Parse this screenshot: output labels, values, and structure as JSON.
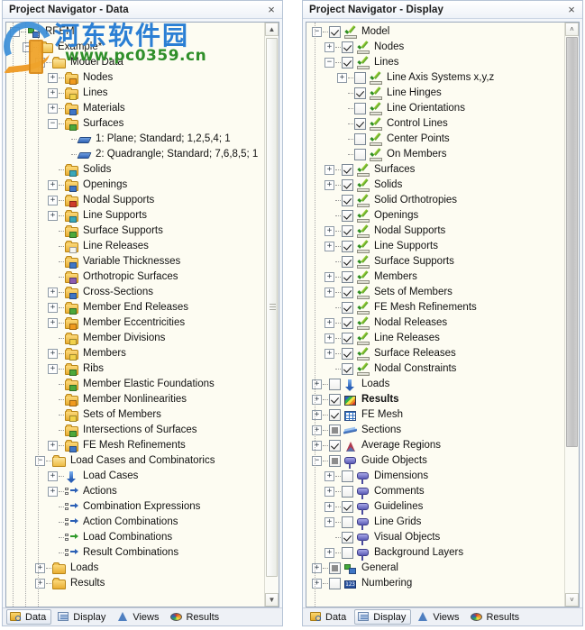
{
  "left_panel": {
    "title": "Project Navigator - Data",
    "close_label": "×",
    "tabs": [
      {
        "label": "Data",
        "icon": "data-icon",
        "active": true
      },
      {
        "label": "Display",
        "icon": "display-icon",
        "active": false
      },
      {
        "label": "Views",
        "icon": "views-icon",
        "active": false
      },
      {
        "label": "Results",
        "icon": "results-icon",
        "active": false
      }
    ],
    "tree": [
      {
        "label": "RFEM",
        "depth": 0,
        "expander": "minus",
        "icon": "rfem",
        "bold": false
      },
      {
        "label": "Example*",
        "depth": 1,
        "expander": "minus",
        "icon": "folder-open",
        "bold": false
      },
      {
        "label": "Model Data",
        "depth": 2,
        "expander": "minus",
        "icon": "folder-open",
        "bold": false
      },
      {
        "label": "Nodes",
        "depth": 3,
        "expander": "plus",
        "icon": "folder-orange",
        "bold": false
      },
      {
        "label": "Lines",
        "depth": 3,
        "expander": "plus",
        "icon": "folder-yellow",
        "bold": false
      },
      {
        "label": "Materials",
        "depth": 3,
        "expander": "plus",
        "icon": "folder-blue",
        "bold": false
      },
      {
        "label": "Surfaces",
        "depth": 3,
        "expander": "minus",
        "icon": "folder-green",
        "bold": false
      },
      {
        "label": "1: Plane; Standard; 1,2,5,4; 1",
        "depth": 4,
        "expander": "none",
        "icon": "surface",
        "bold": false
      },
      {
        "label": "2: Quadrangle; Standard; 7,6,8,5; 1",
        "depth": 4,
        "expander": "none",
        "icon": "surface",
        "bold": false
      },
      {
        "label": "Solids",
        "depth": 3,
        "expander": "none",
        "icon": "folder-cyan",
        "bold": false
      },
      {
        "label": "Openings",
        "depth": 3,
        "expander": "plus",
        "icon": "folder-blue",
        "bold": false
      },
      {
        "label": "Nodal Supports",
        "depth": 3,
        "expander": "plus",
        "icon": "folder-red",
        "bold": false
      },
      {
        "label": "Line Supports",
        "depth": 3,
        "expander": "plus",
        "icon": "folder-cyan",
        "bold": false
      },
      {
        "label": "Surface Supports",
        "depth": 3,
        "expander": "none",
        "icon": "folder-green",
        "bold": false
      },
      {
        "label": "Line Releases",
        "depth": 3,
        "expander": "none",
        "icon": "folder-white",
        "bold": false
      },
      {
        "label": "Variable Thicknesses",
        "depth": 3,
        "expander": "none",
        "icon": "folder-blue",
        "bold": false
      },
      {
        "label": "Orthotropic Surfaces",
        "depth": 3,
        "expander": "none",
        "icon": "folder-purple",
        "bold": false
      },
      {
        "label": "Cross-Sections",
        "depth": 3,
        "expander": "plus",
        "icon": "folder-blue",
        "bold": false
      },
      {
        "label": "Member End Releases",
        "depth": 3,
        "expander": "plus",
        "icon": "folder-green",
        "bold": false
      },
      {
        "label": "Member Eccentricities",
        "depth": 3,
        "expander": "plus",
        "icon": "folder-orange",
        "bold": false
      },
      {
        "label": "Member Divisions",
        "depth": 3,
        "expander": "none",
        "icon": "folder-yellow",
        "bold": false
      },
      {
        "label": "Members",
        "depth": 3,
        "expander": "plus",
        "icon": "folder-yellow",
        "bold": false
      },
      {
        "label": "Ribs",
        "depth": 3,
        "expander": "plus",
        "icon": "folder-green",
        "bold": false
      },
      {
        "label": "Member Elastic Foundations",
        "depth": 3,
        "expander": "none",
        "icon": "folder-green",
        "bold": false
      },
      {
        "label": "Member Nonlinearities",
        "depth": 3,
        "expander": "none",
        "icon": "folder-orange",
        "bold": false
      },
      {
        "label": "Sets of Members",
        "depth": 3,
        "expander": "none",
        "icon": "folder-yellow",
        "bold": false
      },
      {
        "label": "Intersections of Surfaces",
        "depth": 3,
        "expander": "none",
        "icon": "folder-green",
        "bold": false
      },
      {
        "label": "FE Mesh Refinements",
        "depth": 3,
        "expander": "plus",
        "icon": "folder-blue",
        "bold": false
      },
      {
        "label": "Load Cases and Combinatorics",
        "depth": 2,
        "expander": "minus",
        "icon": "folder-open",
        "bold": false
      },
      {
        "label": "Load Cases",
        "depth": 3,
        "expander": "plus",
        "icon": "load-arrow",
        "bold": false
      },
      {
        "label": "Actions",
        "depth": 3,
        "expander": "plus",
        "icon": "combination",
        "bold": false
      },
      {
        "label": "Combination Expressions",
        "depth": 3,
        "expander": "none",
        "icon": "combination",
        "bold": false
      },
      {
        "label": "Action Combinations",
        "depth": 3,
        "expander": "none",
        "icon": "combination",
        "bold": false
      },
      {
        "label": "Load Combinations",
        "depth": 3,
        "expander": "none",
        "icon": "combination-green",
        "bold": false
      },
      {
        "label": "Result Combinations",
        "depth": 3,
        "expander": "none",
        "icon": "combination",
        "bold": false
      },
      {
        "label": "Loads",
        "depth": 2,
        "expander": "plus",
        "icon": "folder-plain",
        "bold": false
      },
      {
        "label": "Results",
        "depth": 2,
        "expander": "plus",
        "icon": "folder-plain",
        "bold": false
      }
    ],
    "scrollbar": {
      "up_arrow": "▲",
      "down_arrow": "▼"
    }
  },
  "right_panel": {
    "title": "Project Navigator - Display",
    "close_label": "×",
    "tabs": [
      {
        "label": "Data",
        "icon": "data-icon",
        "active": false
      },
      {
        "label": "Display",
        "icon": "display-icon",
        "active": true
      },
      {
        "label": "Views",
        "icon": "views-icon",
        "active": false
      },
      {
        "label": "Results",
        "icon": "results-icon",
        "active": false
      }
    ],
    "tree": [
      {
        "label": "Model",
        "depth": 0,
        "expander": "minus",
        "check": "checked",
        "icon": "display",
        "bold": false
      },
      {
        "label": "Nodes",
        "depth": 1,
        "expander": "plus",
        "check": "checked",
        "icon": "display",
        "bold": false
      },
      {
        "label": "Lines",
        "depth": 1,
        "expander": "minus",
        "check": "checked",
        "icon": "display",
        "bold": false
      },
      {
        "label": "Line Axis Systems x,y,z",
        "depth": 2,
        "expander": "plus",
        "check": "unchecked",
        "icon": "display",
        "bold": false
      },
      {
        "label": "Line Hinges",
        "depth": 2,
        "expander": "none",
        "check": "checked",
        "icon": "display",
        "bold": false
      },
      {
        "label": "Line Orientations",
        "depth": 2,
        "expander": "none",
        "check": "unchecked",
        "icon": "display",
        "bold": false
      },
      {
        "label": "Control Lines",
        "depth": 2,
        "expander": "none",
        "check": "checked",
        "icon": "display",
        "bold": false
      },
      {
        "label": "Center Points",
        "depth": 2,
        "expander": "none",
        "check": "unchecked",
        "icon": "display",
        "bold": false
      },
      {
        "label": "On Members",
        "depth": 2,
        "expander": "none",
        "check": "unchecked",
        "icon": "display",
        "bold": false
      },
      {
        "label": "Surfaces",
        "depth": 1,
        "expander": "plus",
        "check": "checked",
        "icon": "display",
        "bold": false
      },
      {
        "label": "Solids",
        "depth": 1,
        "expander": "plus",
        "check": "checked",
        "icon": "display",
        "bold": false
      },
      {
        "label": "Solid Orthotropies",
        "depth": 1,
        "expander": "none",
        "check": "checked",
        "icon": "display",
        "bold": false
      },
      {
        "label": "Openings",
        "depth": 1,
        "expander": "none",
        "check": "checked",
        "icon": "display",
        "bold": false
      },
      {
        "label": "Nodal Supports",
        "depth": 1,
        "expander": "plus",
        "check": "checked",
        "icon": "display",
        "bold": false
      },
      {
        "label": "Line Supports",
        "depth": 1,
        "expander": "plus",
        "check": "checked",
        "icon": "display",
        "bold": false
      },
      {
        "label": "Surface Supports",
        "depth": 1,
        "expander": "none",
        "check": "checked",
        "icon": "display",
        "bold": false
      },
      {
        "label": "Members",
        "depth": 1,
        "expander": "plus",
        "check": "checked",
        "icon": "display",
        "bold": false
      },
      {
        "label": "Sets of Members",
        "depth": 1,
        "expander": "plus",
        "check": "checked",
        "icon": "display",
        "bold": false
      },
      {
        "label": "FE Mesh Refinements",
        "depth": 1,
        "expander": "none",
        "check": "checked",
        "icon": "display",
        "bold": false
      },
      {
        "label": "Nodal Releases",
        "depth": 1,
        "expander": "plus",
        "check": "checked",
        "icon": "display",
        "bold": false
      },
      {
        "label": "Line Releases",
        "depth": 1,
        "expander": "plus",
        "check": "checked",
        "icon": "display",
        "bold": false
      },
      {
        "label": "Surface Releases",
        "depth": 1,
        "expander": "plus",
        "check": "checked",
        "icon": "display",
        "bold": false
      },
      {
        "label": "Nodal Constraints",
        "depth": 1,
        "expander": "none",
        "check": "checked",
        "icon": "display",
        "bold": false
      },
      {
        "label": "Loads",
        "depth": 0,
        "expander": "plus",
        "check": "unchecked",
        "icon": "load-arrow",
        "bold": false
      },
      {
        "label": "Results",
        "depth": 0,
        "expander": "plus",
        "check": "checked",
        "icon": "results",
        "bold": true
      },
      {
        "label": "FE Mesh",
        "depth": 0,
        "expander": "plus",
        "check": "checked",
        "icon": "mesh",
        "bold": false
      },
      {
        "label": "Sections",
        "depth": 0,
        "expander": "plus",
        "check": "tri",
        "icon": "sections",
        "bold": false
      },
      {
        "label": "Average Regions",
        "depth": 0,
        "expander": "plus",
        "check": "checked",
        "icon": "cone",
        "bold": false
      },
      {
        "label": "Guide Objects",
        "depth": 0,
        "expander": "minus",
        "check": "tri",
        "icon": "balloon",
        "bold": false
      },
      {
        "label": "Dimensions",
        "depth": 1,
        "expander": "plus",
        "check": "unchecked",
        "icon": "balloon",
        "bold": false
      },
      {
        "label": "Comments",
        "depth": 1,
        "expander": "plus",
        "check": "unchecked",
        "icon": "balloon",
        "bold": false
      },
      {
        "label": "Guidelines",
        "depth": 1,
        "expander": "plus",
        "check": "checked",
        "icon": "balloon",
        "bold": false
      },
      {
        "label": "Line Grids",
        "depth": 1,
        "expander": "plus",
        "check": "unchecked",
        "icon": "balloon",
        "bold": false
      },
      {
        "label": "Visual Objects",
        "depth": 1,
        "expander": "none",
        "check": "checked",
        "icon": "balloon",
        "bold": false
      },
      {
        "label": "Background Layers",
        "depth": 1,
        "expander": "plus",
        "check": "unchecked",
        "icon": "balloon",
        "bold": false
      },
      {
        "label": "General",
        "depth": 0,
        "expander": "plus",
        "check": "tri",
        "icon": "general",
        "bold": false
      },
      {
        "label": "Numbering",
        "depth": 0,
        "expander": "plus",
        "check": "unchecked",
        "icon": "numbering",
        "bold": false
      }
    ],
    "scrollbar": {
      "up_arrow": "˄",
      "down_arrow": "˅"
    }
  },
  "watermark": {
    "chinese": "河东软件园",
    "url": "www.pc0359.cn"
  },
  "numbering_icon_text": "123"
}
